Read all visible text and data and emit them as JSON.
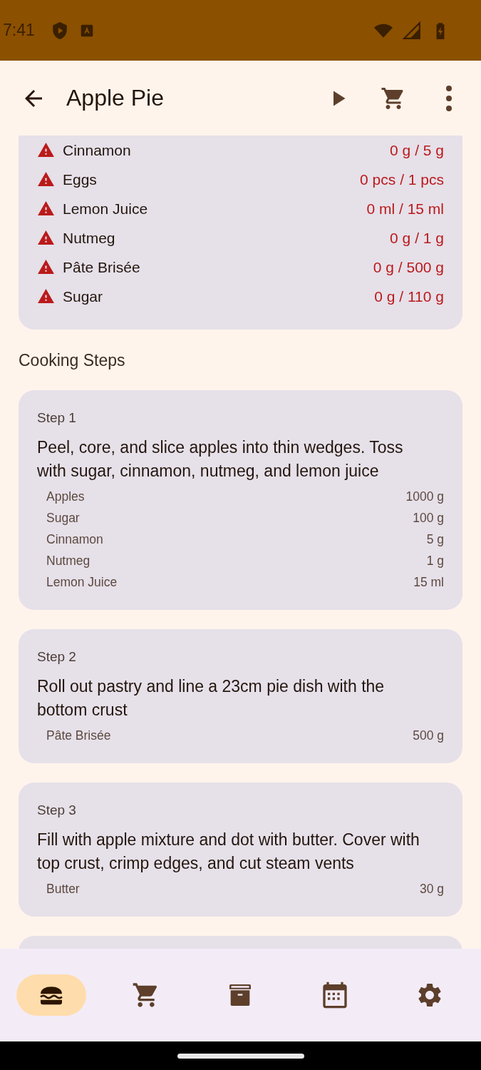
{
  "status_bar": {
    "time": "7:41"
  },
  "app_bar": {
    "title": "Apple Pie"
  },
  "ingredients": [
    {
      "name": "Cinnamon",
      "amount": "0 g / 5 g",
      "missing": true
    },
    {
      "name": "Eggs",
      "amount": "0 pcs / 1 pcs",
      "missing": true
    },
    {
      "name": "Lemon Juice",
      "amount": "0 ml / 15 ml",
      "missing": true
    },
    {
      "name": "Nutmeg",
      "amount": "0 g / 1 g",
      "missing": true
    },
    {
      "name": "Pâte Brisée",
      "amount": "0 g / 500 g",
      "missing": true
    },
    {
      "name": "Sugar",
      "amount": "0 g / 110 g",
      "missing": true
    }
  ],
  "cooking_steps": {
    "heading": "Cooking Steps",
    "steps": [
      {
        "title": "Step 1",
        "text": "Peel, core, and slice apples into thin wedges. Toss with sugar, cinnamon, nutmeg, and lemon juice",
        "ingredients": [
          {
            "name": "Apples",
            "amount": "1000 g"
          },
          {
            "name": "Sugar",
            "amount": "100 g"
          },
          {
            "name": "Cinnamon",
            "amount": "5 g"
          },
          {
            "name": "Nutmeg",
            "amount": "1 g"
          },
          {
            "name": "Lemon Juice",
            "amount": "15 ml"
          }
        ]
      },
      {
        "title": "Step 2",
        "text": "Roll out pastry and line a 23cm pie dish with the bottom crust",
        "ingredients": [
          {
            "name": "Pâte Brisée",
            "amount": "500 g"
          }
        ]
      },
      {
        "title": "Step 3",
        "text": "Fill with apple mixture and dot with butter. Cover with top crust, crimp edges, and cut steam vents",
        "ingredients": [
          {
            "name": "Butter",
            "amount": "30 g"
          }
        ]
      }
    ]
  },
  "bottom_nav": [
    {
      "selected": true
    },
    {
      "selected": false
    },
    {
      "selected": false
    },
    {
      "selected": false
    },
    {
      "selected": false
    }
  ]
}
